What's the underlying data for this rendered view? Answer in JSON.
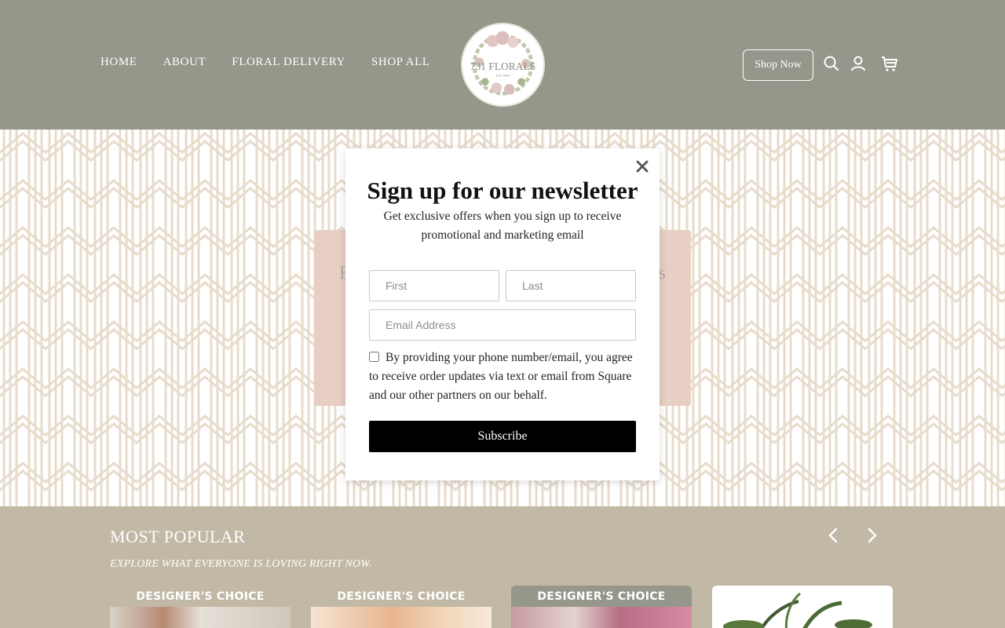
{
  "header": {
    "nav": [
      "HOME",
      "ABOUT",
      "FLORAL DELIVERY",
      "SHOP ALL"
    ],
    "logo_text": "731 FLORALS",
    "logo_est": "EST. 2024",
    "shop_now_label": "Shop Now",
    "icons": [
      "search-icon",
      "account-icon",
      "cart-icon"
    ]
  },
  "hero": {
    "card_text_left": "F",
    "card_text_right": "s"
  },
  "newsletter": {
    "title": "Sign up for our newsletter",
    "subtitle": "Get exclusive offers when you sign up to receive promotional and marketing email",
    "first_placeholder": "First",
    "last_placeholder": "Last",
    "email_placeholder": "Email Address",
    "consent_text": "By providing your phone number/email, you agree to receive order updates via text or email from Square and our other partners on our behalf.",
    "subscribe_label": "Subscribe"
  },
  "popular": {
    "title": "MOST POPULAR",
    "subtitle": "EXPLORE WHAT EVERYONE IS LOVING RIGHT NOW.",
    "cards": [
      {
        "label": "DESIGNER'S CHOICE"
      },
      {
        "label": "DESIGNER'S CHOICE"
      },
      {
        "label": "DESIGNER'S CHOICE"
      },
      {
        "label": ""
      }
    ]
  },
  "colors": {
    "header_bg": "#95978a",
    "section_bg": "#c1b9a6",
    "pattern": "#e7dccb",
    "hero_card": "#e8cfc4",
    "button": "#000000"
  }
}
